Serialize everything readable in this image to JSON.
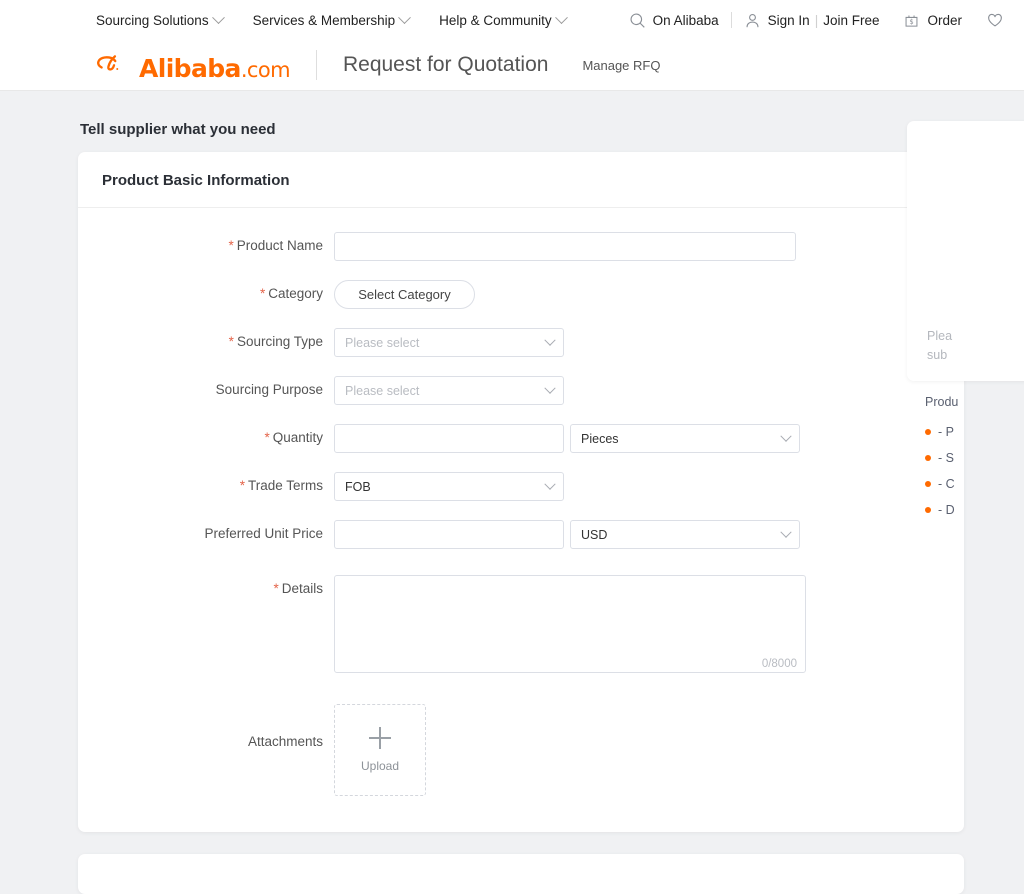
{
  "topbar": {
    "nav": [
      {
        "label": "Sourcing Solutions",
        "icon": "chevron-down-icon"
      },
      {
        "label": "Services & Membership",
        "icon": "chevron-down-icon"
      },
      {
        "label": "Help & Community",
        "icon": "chevron-down-icon"
      }
    ],
    "search": {
      "label": "On Alibaba",
      "icon": "search-icon"
    },
    "account": {
      "icon": "user-icon",
      "sign_in": "Sign In",
      "separator": "|",
      "join_free": "Join Free"
    },
    "order": {
      "label": "Order",
      "icon": "order-bag-icon"
    },
    "favorites": {
      "icon": "heart-icon"
    }
  },
  "header": {
    "logo_text": "Alibaba",
    "logo_suffix": ".com",
    "logo_icon": "alibaba-logo-icon",
    "page_title": "Request for Quotation",
    "manage_link": "Manage RFQ"
  },
  "main": {
    "section_title": "Tell supplier what you need",
    "card_title": "Product Basic Information",
    "fields": {
      "product_name": {
        "label": "Product Name",
        "required": true,
        "value": "",
        "placeholder": ""
      },
      "category": {
        "label": "Category",
        "required": true,
        "button_label": "Select Category"
      },
      "sourcing_type": {
        "label": "Sourcing Type",
        "required": true,
        "value": "",
        "placeholder": "Please select"
      },
      "sourcing_purpose": {
        "label": "Sourcing Purpose",
        "required": false,
        "value": "",
        "placeholder": "Please select"
      },
      "quantity": {
        "label": "Quantity",
        "required": true,
        "value": "",
        "placeholder": "",
        "unit": "Pieces"
      },
      "trade_terms": {
        "label": "Trade Terms",
        "required": true,
        "value": "FOB"
      },
      "unit_price": {
        "label": "Preferred Unit Price",
        "required": false,
        "value": "",
        "placeholder": "",
        "currency": "USD"
      },
      "details": {
        "label": "Details",
        "required": true,
        "value": "",
        "placeholder": "",
        "counter": "0/8000"
      },
      "attachments": {
        "label": "Attachments",
        "required": false,
        "upload_label": "Upload",
        "upload_icon": "plus-icon"
      }
    }
  },
  "aside": {
    "note_line1": "Plea",
    "note_line2": "sub",
    "tips_title": "Produ",
    "tips": [
      {
        "text": "- P"
      },
      {
        "text": "- S"
      },
      {
        "text": "- C"
      },
      {
        "text": "- D"
      }
    ]
  },
  "colors": {
    "brand_orange": "#ff6a00",
    "required_red": "#e4644a",
    "page_bg": "#f0f1f3",
    "border": "#dcdfe6"
  }
}
